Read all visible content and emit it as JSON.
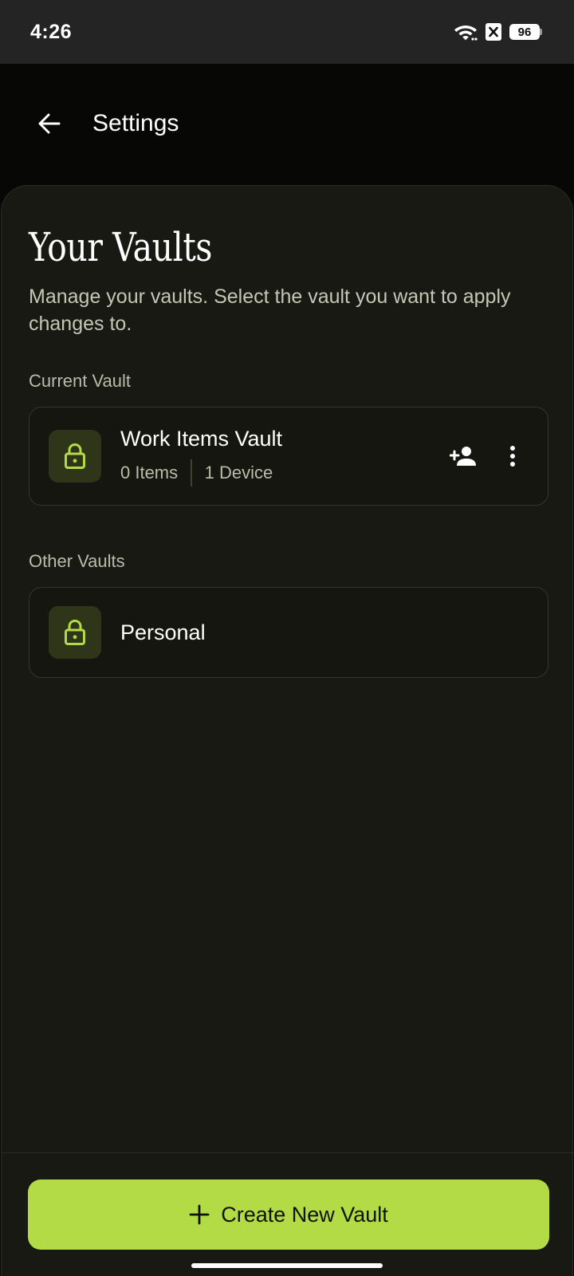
{
  "status_bar": {
    "time": "4:26",
    "battery_level": "96",
    "icons": [
      "wifi-icon",
      "notification-x-icon",
      "battery-icon"
    ]
  },
  "top_bar": {
    "back_icon": "arrow-back-icon",
    "title": "Settings"
  },
  "main": {
    "title": "Your Vaults",
    "description": "Manage your vaults. Select the vault you want to apply changes to.",
    "current_section_label": "Current Vault",
    "current_vault": {
      "name": "Work Items Vault",
      "items": "0 Items",
      "devices": "1 Device",
      "icon": "lock-icon",
      "actions": [
        "add-person-icon",
        "more-vert-icon"
      ]
    },
    "other_section_label": "Other Vaults",
    "other_vaults": [
      {
        "name": "Personal",
        "icon": "lock-icon"
      }
    ]
  },
  "footer": {
    "create_button_label": "Create New Vault",
    "create_icon": "plus-icon"
  },
  "colors": {
    "accent": "#b2db45",
    "lock_icon": "#b2db45",
    "icon_box": "#2e3519",
    "panel_bg": "#171912",
    "app_bg": "#070806"
  }
}
